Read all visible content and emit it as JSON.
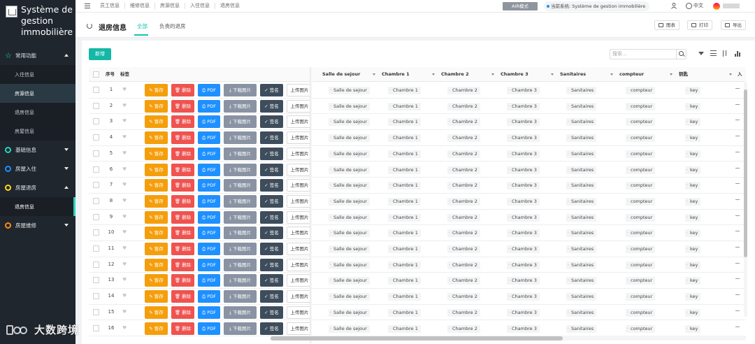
{
  "sidebar": {
    "title": "Système de gestion immobilière",
    "groups": [
      {
        "label": "常用功能",
        "color": "#2bd1c0",
        "expanded": true
      },
      {
        "label": "基础信息",
        "color": "#2bd1c0",
        "expanded": false
      },
      {
        "label": "房屋入住",
        "color": "#1890ff",
        "expanded": false
      },
      {
        "label": "房屋退房",
        "color": "#fadb14",
        "expanded": true
      },
      {
        "label": "房屋维修",
        "color": "#fa8c16",
        "expanded": false
      }
    ],
    "sub_common": [
      "入住信息",
      "房源信息",
      "退房信息",
      "房屋信息"
    ],
    "sub_checkout": [
      "退房信息"
    ]
  },
  "topbar": {
    "tabs": [
      "员工信息",
      "维修信息",
      "房源信息",
      "入住信息",
      "退房信息"
    ],
    "air_mode": "AIR模式",
    "system_pill": "当前系统: Système de gestion immobilière",
    "language": "中文"
  },
  "page": {
    "title": "退房信息",
    "tab_all": "全部",
    "tab_mine": "负责的退房",
    "btn_chart": "图表",
    "btn_print": "打印",
    "btn_export": "导出"
  },
  "toolbar": {
    "add_label": "新增",
    "search_placeholder": "搜索..."
  },
  "table": {
    "headers": {
      "index": "序号",
      "tag": "标签",
      "salle": "Salle de sejour",
      "chambre1": "Chambre 1",
      "chambre2": "Chambre 2",
      "chambre3": "Chambre 3",
      "sanitaires": "Sanitaires",
      "compteur": "compteur",
      "key": "钥匙",
      "more": "入住"
    },
    "actions": {
      "save": "暂存",
      "delete": "删除",
      "pdf": "PDF",
      "download": "下载图片",
      "sign": "签名",
      "upload": "上传图片"
    },
    "rows": [
      {
        "n": "1",
        "salle": "Salle de sejour",
        "c1": "Chambre 1",
        "c2": "Chambre 2",
        "c3": "Chambre 3",
        "san": "Sanitaires",
        "cpt": "compteur",
        "key": "key"
      },
      {
        "n": "2",
        "salle": "Salle de sejour",
        "c1": "Chambre 1",
        "c2": "Chambre 2",
        "c3": "Chambre 3",
        "san": "Sanitaires",
        "cpt": "compteur",
        "key": "key"
      },
      {
        "n": "3",
        "salle": "Salle de sejour",
        "c1": "Chambre 1",
        "c2": "Chambre 2",
        "c3": "Chambre 3",
        "san": "Sanitaires",
        "cpt": "compteur",
        "key": "key"
      },
      {
        "n": "4",
        "salle": "Salle de sejour",
        "c1": "Chambre 1",
        "c2": "Chambre 2",
        "c3": "Chambre 3",
        "san": "Sanitaires",
        "cpt": "compteur",
        "key": "key"
      },
      {
        "n": "5",
        "salle": "Salle de sejour",
        "c1": "Chambre 1",
        "c2": "Chambre 2",
        "c3": "Chambre 3",
        "san": "Sanitaires",
        "cpt": "compteur",
        "key": "key"
      },
      {
        "n": "6",
        "salle": "Salle de sejour",
        "c1": "Chambre 1",
        "c2": "Chambre 2",
        "c3": "Chambre 3",
        "san": "Sanitaires",
        "cpt": "compteur",
        "key": "key"
      },
      {
        "n": "7",
        "salle": "Salle de sejour",
        "c1": "Chambre 1",
        "c2": "Chambre 2",
        "c3": "Chambre 3",
        "san": "Sanitaires",
        "cpt": "compteur",
        "key": "key"
      },
      {
        "n": "8",
        "salle": "Salle de sejour",
        "c1": "Chambre 1",
        "c2": "Chambre 2",
        "c3": "Chambre 3",
        "san": "Sanitaires",
        "cpt": "compteur",
        "key": "key"
      },
      {
        "n": "9",
        "salle": "Salle de sejour",
        "c1": "Chambre 1",
        "c2": "Chambre 2",
        "c3": "Chambre 3",
        "san": "Sanitaires",
        "cpt": "compteur",
        "key": "key"
      },
      {
        "n": "10",
        "salle": "Salle de sejour",
        "c1": "Chambre 1",
        "c2": "Chambre 2",
        "c3": "Chambre 3",
        "san": "Sanitaires",
        "cpt": "compteur",
        "key": "key"
      },
      {
        "n": "11",
        "salle": "Salle de sejour",
        "c1": "Chambre 1",
        "c2": "Chambre 2",
        "c3": "Chambre 3",
        "san": "Sanitaires",
        "cpt": "compteur",
        "key": "key"
      },
      {
        "n": "12",
        "salle": "Salle de sejour",
        "c1": "Chambre 1",
        "c2": "Chambre 2",
        "c3": "Chambre 3",
        "san": "Sanitaires",
        "cpt": "compteur",
        "key": "key"
      },
      {
        "n": "13",
        "salle": "Salle de sejour",
        "c1": "Chambre 1",
        "c2": "Chambre 2",
        "c3": "Chambre 3",
        "san": "Sanitaires",
        "cpt": "compteur",
        "key": "key"
      },
      {
        "n": "14",
        "salle": "Salle de sejour",
        "c1": "Chambre 1",
        "c2": "Chambre 2",
        "c3": "Chambre 3",
        "san": "Sanitaires",
        "cpt": "compteur",
        "key": "key"
      },
      {
        "n": "15",
        "salle": "Salle de sejour",
        "c1": "Chambre 1",
        "c2": "Chambre 2",
        "c3": "Chambre 3",
        "san": "Sanitaires",
        "cpt": "compteur",
        "key": "key"
      },
      {
        "n": "16",
        "salle": "Salle de sejour",
        "c1": "Chambre 1",
        "c2": "Chambre 2",
        "c3": "Chambre 3",
        "san": "Sanitaires",
        "cpt": "compteur",
        "key": "key"
      }
    ]
  },
  "watermark": {
    "text": "大数跨境"
  },
  "colors": {
    "accent": "#14b8a6",
    "save": "#f59e0b",
    "delete": "#ef5350",
    "pdf": "#1e90ff",
    "download": "#8a93a3",
    "sign": "#3e4d5c",
    "sidebar": "#20262e"
  }
}
